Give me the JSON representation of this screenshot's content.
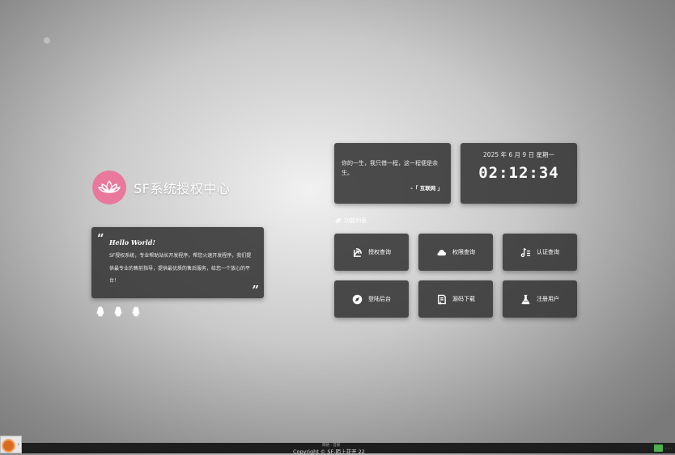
{
  "brand": {
    "title": "SF系统授权中心",
    "logo_icon": "lotus-icon",
    "logo_color": "#e8799c"
  },
  "intro": {
    "heading": "Hello World!",
    "text": "SF授权系统，专业帮助站长开发程序，帮您火速开发程序，我们提供最专业的售前指导，提供最优质的售后服务，给您一个放心的平台！"
  },
  "social_icons": [
    "qq-icon",
    "qq-icon",
    "qq-icon"
  ],
  "poem": {
    "text": "你的一生，我只借一程，这一程便是余生。",
    "source": "-「 互联网 」"
  },
  "clock": {
    "date": "2025 年 6 月 9 日 星期一",
    "time": "02:12:34"
  },
  "functions": {
    "label": "功能列表",
    "items": [
      {
        "label": "授权查询",
        "icon": "satellite-icon"
      },
      {
        "label": "权限查询",
        "icon": "cloud-icon"
      },
      {
        "label": "认证查询",
        "icon": "music-list-icon"
      },
      {
        "label": "登陆后台",
        "icon": "compass-icon"
      },
      {
        "label": "源码下载",
        "icon": "document-download-icon"
      },
      {
        "label": "注册用户",
        "icon": "flask-icon"
      }
    ]
  },
  "footer": {
    "copyright": "Copyright © SF-陌上花开   22",
    "tiny": "网络 · 音频"
  }
}
